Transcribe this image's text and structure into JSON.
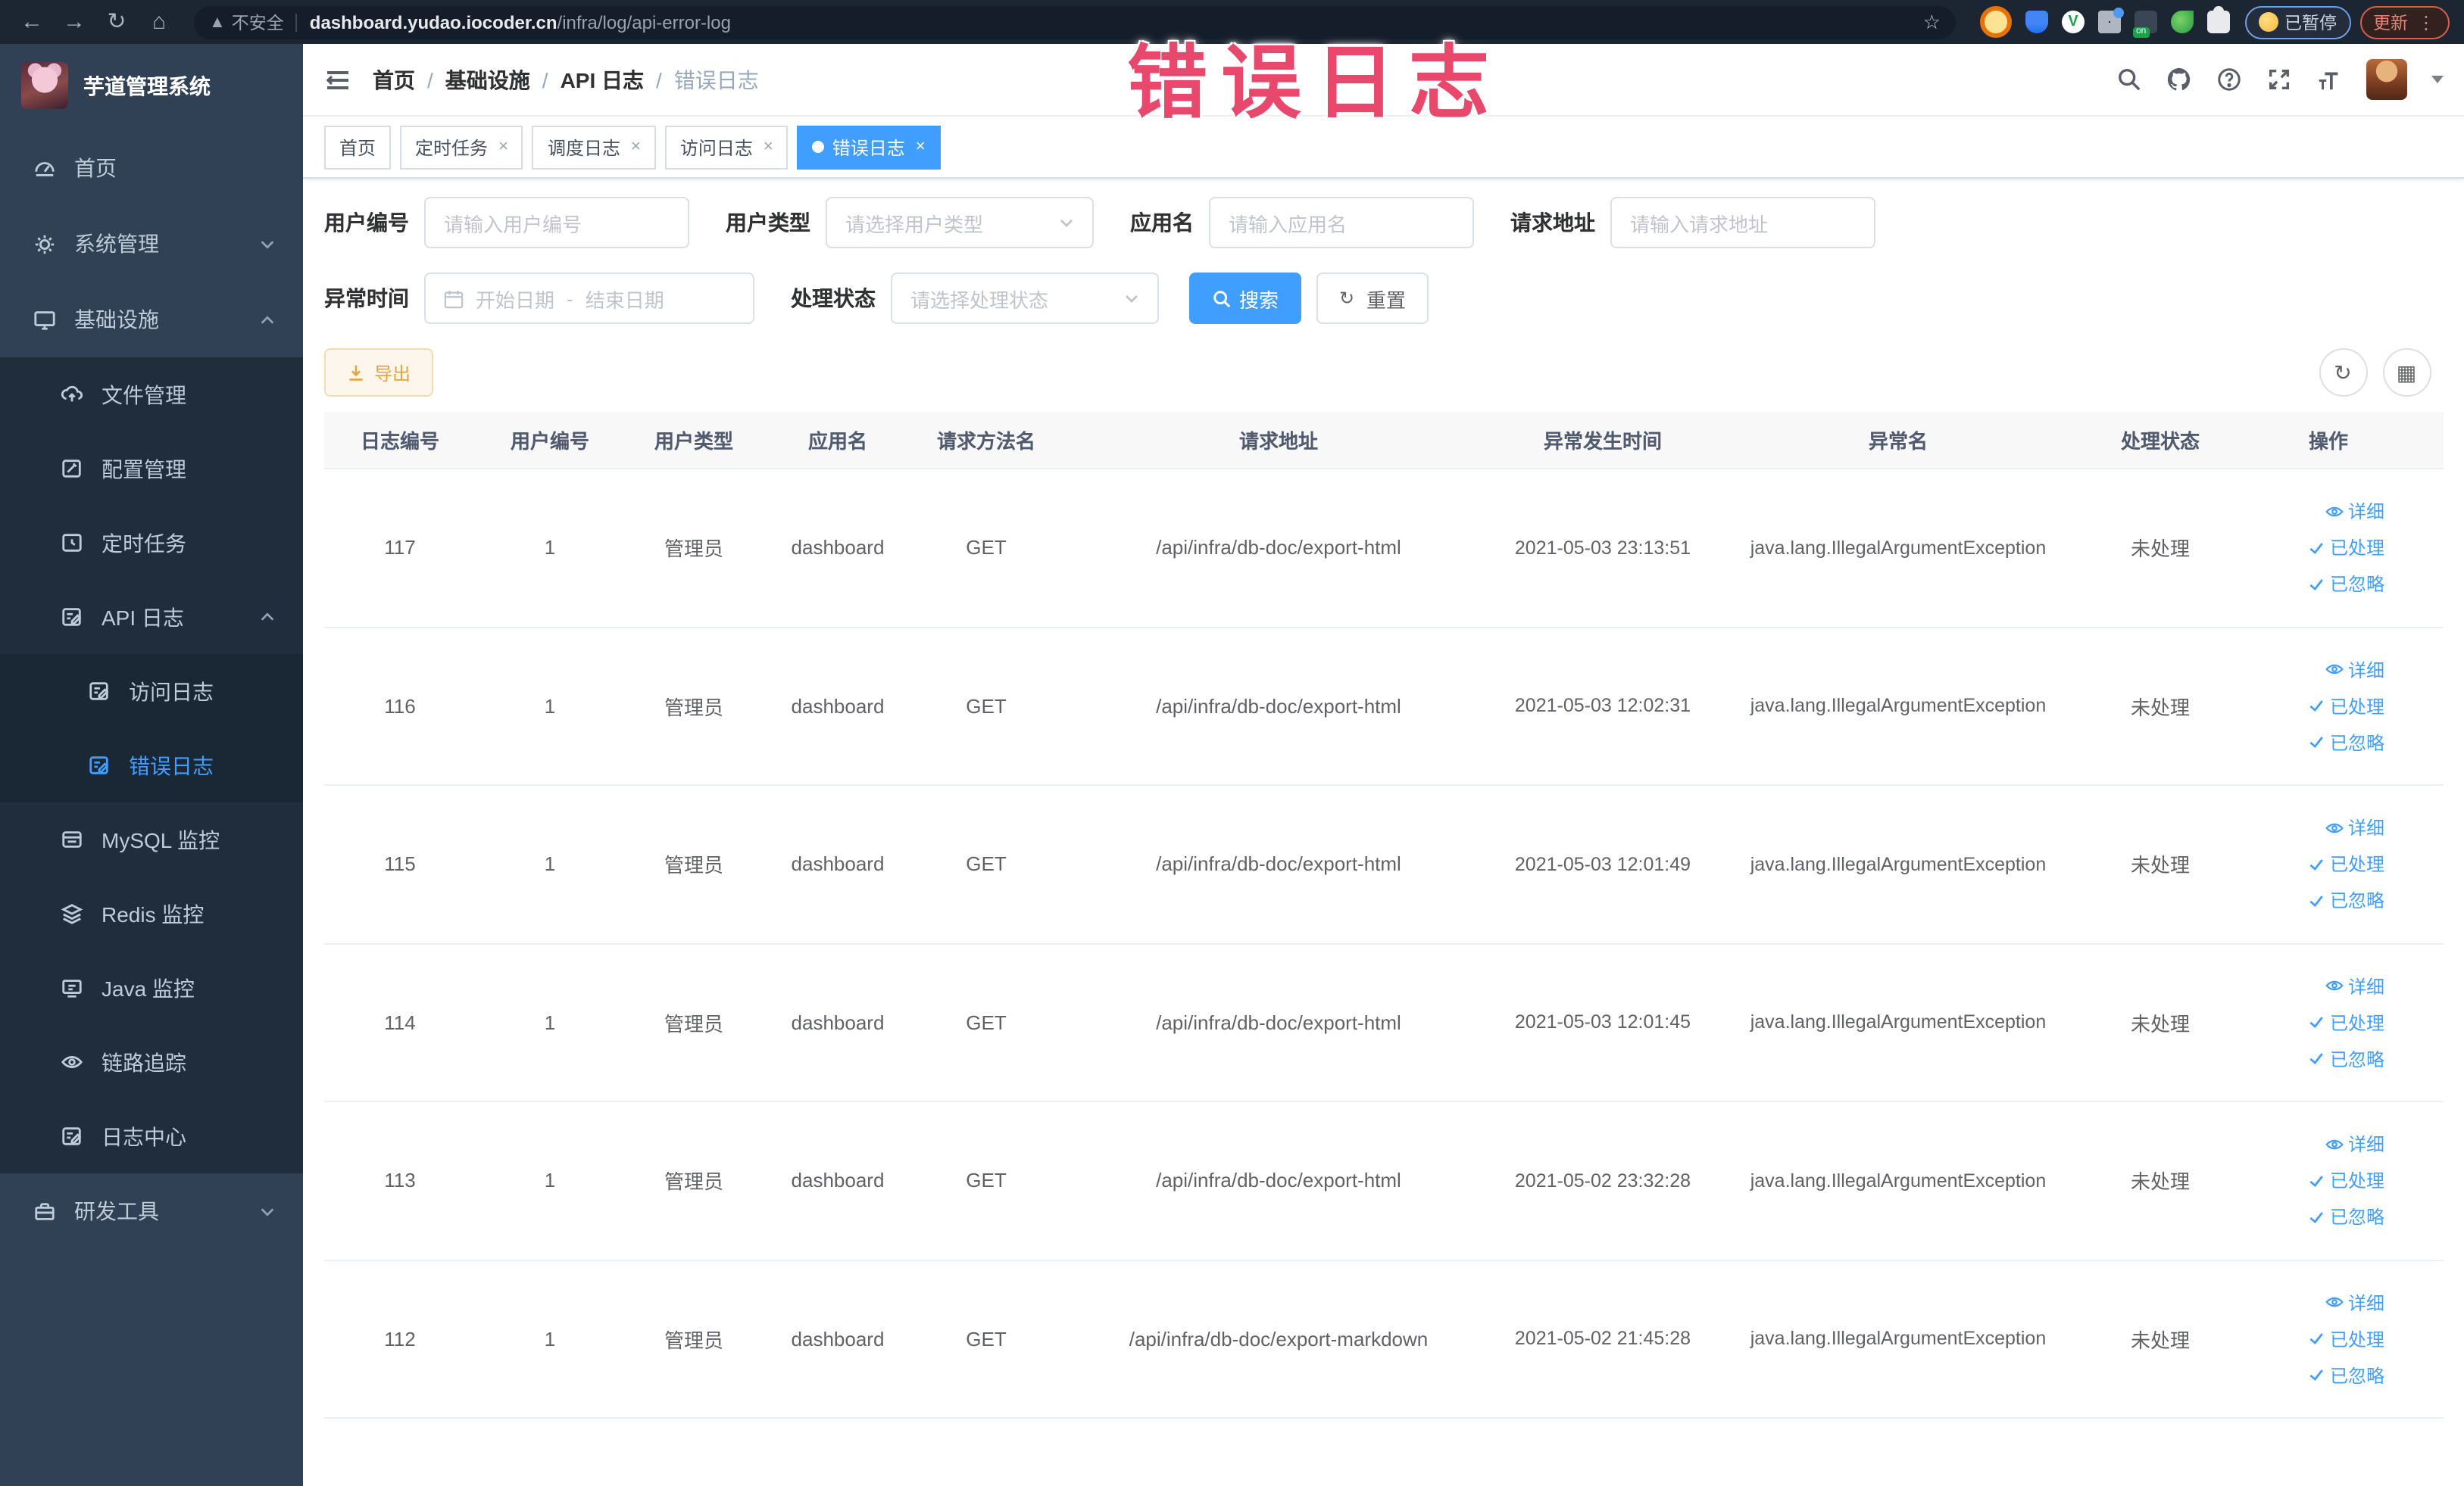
{
  "browser": {
    "security_label": "不安全",
    "url_host": "dashboard.yudao.iocoder.cn",
    "url_path": "/infra/log/api-error-log",
    "paused_badge": "已暂停",
    "update_button": "更新"
  },
  "overlay": {
    "title": "错误日志"
  },
  "sidebar": {
    "app_title": "芋道管理系统",
    "items": [
      {
        "label": "首页",
        "icon": "home-icon",
        "level": 1
      },
      {
        "label": "系统管理",
        "icon": "gear-icon",
        "level": 1,
        "chevron": "down"
      },
      {
        "label": "基础设施",
        "icon": "monitor-icon",
        "level": 1,
        "chevron": "up"
      },
      {
        "label": "文件管理",
        "icon": "upload-icon",
        "level": 2
      },
      {
        "label": "配置管理",
        "icon": "edit-icon",
        "level": 2
      },
      {
        "label": "定时任务",
        "icon": "timer-icon",
        "level": 2
      },
      {
        "label": "API 日志",
        "icon": "log-icon",
        "level": 2,
        "chevron": "up"
      },
      {
        "label": "访问日志",
        "icon": "log-icon",
        "level": 3
      },
      {
        "label": "错误日志",
        "icon": "log-icon",
        "level": 3,
        "active": true
      },
      {
        "label": "MySQL 监控",
        "icon": "database-icon",
        "level": 2
      },
      {
        "label": "Redis 监控",
        "icon": "layers-icon",
        "level": 2
      },
      {
        "label": "Java 监控",
        "icon": "java-icon",
        "level": 2
      },
      {
        "label": "链路追踪",
        "icon": "eye-icon",
        "level": 2
      },
      {
        "label": "日志中心",
        "icon": "log-icon",
        "level": 2
      },
      {
        "label": "研发工具",
        "icon": "toolbox-icon",
        "level": 1,
        "chevron": "down"
      }
    ]
  },
  "breadcrumb": [
    "首页",
    "基础设施",
    "API 日志",
    "错误日志"
  ],
  "tabs": [
    {
      "label": "首页",
      "closable": false,
      "active": false
    },
    {
      "label": "定时任务",
      "closable": true,
      "active": false
    },
    {
      "label": "调度日志",
      "closable": true,
      "active": false
    },
    {
      "label": "访问日志",
      "closable": true,
      "active": false
    },
    {
      "label": "错误日志",
      "closable": true,
      "active": true
    }
  ],
  "filters": {
    "user_id": {
      "label": "用户编号",
      "placeholder": "请输入用户编号"
    },
    "user_type": {
      "label": "用户类型",
      "placeholder": "请选择用户类型"
    },
    "app_name": {
      "label": "应用名",
      "placeholder": "请输入应用名"
    },
    "request_url": {
      "label": "请求地址",
      "placeholder": "请输入请求地址"
    },
    "exception_time": {
      "label": "异常时间",
      "start_placeholder": "开始日期",
      "separator": "-",
      "end_placeholder": "结束日期"
    },
    "process_status": {
      "label": "处理状态",
      "placeholder": "请选择处理状态"
    },
    "search_button": "搜索",
    "reset_button": "重置"
  },
  "toolbar": {
    "export_button": "导出"
  },
  "table": {
    "columns": [
      "日志编号",
      "用户编号",
      "用户类型",
      "应用名",
      "请求方法名",
      "请求地址",
      "异常发生时间",
      "异常名",
      "处理状态",
      "操作"
    ],
    "actions": [
      "详细",
      "已处理",
      "已忽略"
    ],
    "rows": [
      {
        "id": "117",
        "user_id": "1",
        "user_type": "管理员",
        "app": "dashboard",
        "method": "GET",
        "url": "/api/infra/db-doc/export-html",
        "time": "2021-05-03 23:13:51",
        "exception": "java.lang.IllegalArgumentException",
        "status": "未处理"
      },
      {
        "id": "116",
        "user_id": "1",
        "user_type": "管理员",
        "app": "dashboard",
        "method": "GET",
        "url": "/api/infra/db-doc/export-html",
        "time": "2021-05-03 12:02:31",
        "exception": "java.lang.IllegalArgumentException",
        "status": "未处理"
      },
      {
        "id": "115",
        "user_id": "1",
        "user_type": "管理员",
        "app": "dashboard",
        "method": "GET",
        "url": "/api/infra/db-doc/export-html",
        "time": "2021-05-03 12:01:49",
        "exception": "java.lang.IllegalArgumentException",
        "status": "未处理"
      },
      {
        "id": "114",
        "user_id": "1",
        "user_type": "管理员",
        "app": "dashboard",
        "method": "GET",
        "url": "/api/infra/db-doc/export-html",
        "time": "2021-05-03 12:01:45",
        "exception": "java.lang.IllegalArgumentException",
        "status": "未处理"
      },
      {
        "id": "113",
        "user_id": "1",
        "user_type": "管理员",
        "app": "dashboard",
        "method": "GET",
        "url": "/api/infra/db-doc/export-html",
        "time": "2021-05-02 23:32:28",
        "exception": "java.lang.IllegalArgumentException",
        "status": "未处理"
      },
      {
        "id": "112",
        "user_id": "1",
        "user_type": "管理员",
        "app": "dashboard",
        "method": "GET",
        "url": "/api/infra/db-doc/export-markdown",
        "time": "2021-05-02 21:45:28",
        "exception": "java.lang.IllegalArgumentException",
        "status": "未处理"
      }
    ]
  },
  "colors": {
    "primary": "#409eff",
    "warning": "#e6a23c",
    "sidebar_bg": "#304156",
    "submenu_bg": "#1f2d3d",
    "overlay_pink": "#e8486b",
    "chrome_bg": "#1c2633"
  }
}
